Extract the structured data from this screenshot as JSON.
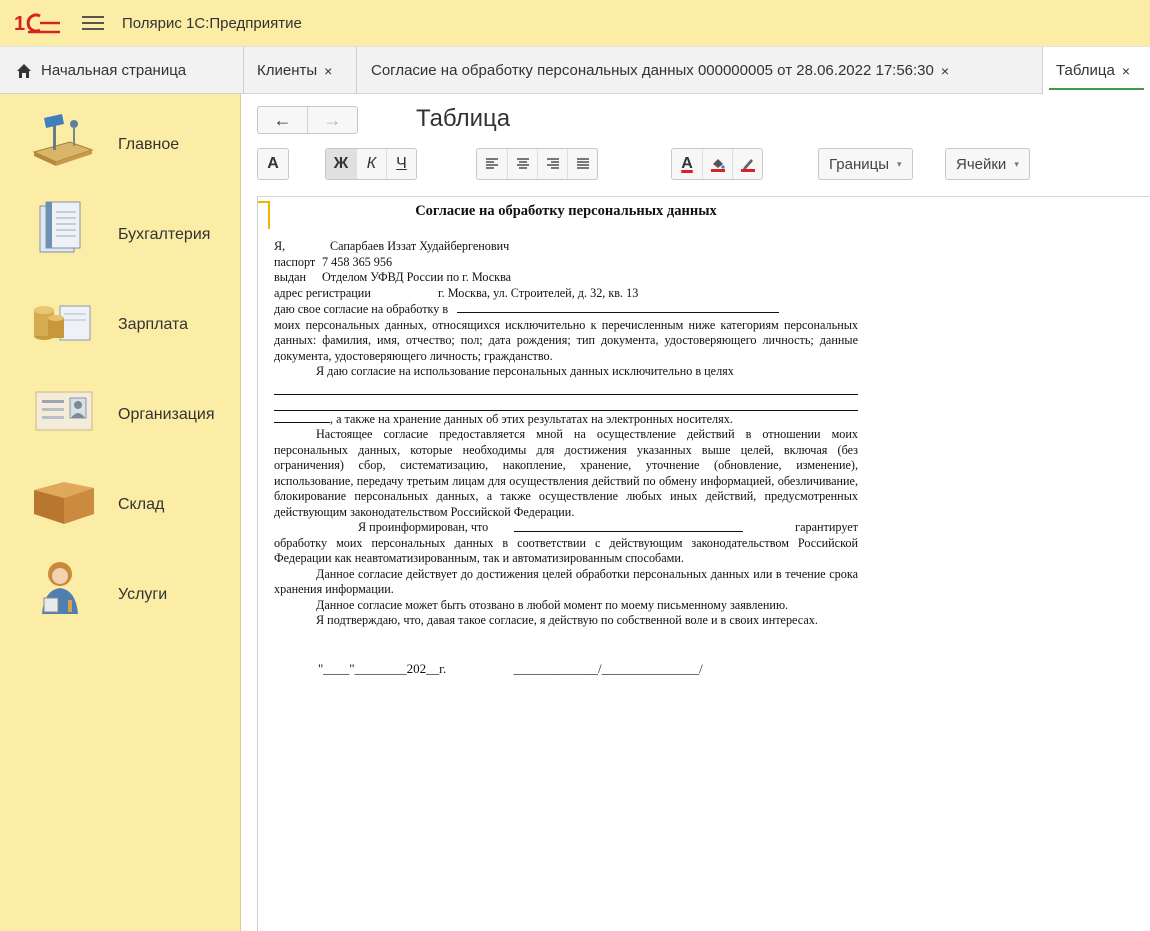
{
  "app": {
    "title": "Полярис 1С:Предприятие",
    "logo_text": "1С",
    "colors": {
      "accent": "#fbeca6",
      "brand_red": "#d6231f",
      "active_tab_underline": "#3d9a4b"
    }
  },
  "tabs": {
    "home": "Начальная страница",
    "open": [
      {
        "label": "Клиенты"
      },
      {
        "label": "Согласие на обработку персональных данных 000000005 от 28.06.2022 17:56:30"
      },
      {
        "label": "Таблица"
      }
    ],
    "close_glyph": "×"
  },
  "sidebar": {
    "items": [
      {
        "label": "Главное",
        "icon": "desk-lamp-icon"
      },
      {
        "label": "Бухгалтерия",
        "icon": "ledger-books-icon"
      },
      {
        "label": "Зарплата",
        "icon": "coins-icon"
      },
      {
        "label": "Организация",
        "icon": "id-card-icon"
      },
      {
        "label": "Склад",
        "icon": "box-icon"
      },
      {
        "label": "Услуги",
        "icon": "service-person-icon"
      }
    ]
  },
  "content": {
    "title": "Таблица",
    "nav": {
      "back": "←",
      "forward": "→"
    },
    "toolbar": {
      "font": "А",
      "bold": "Ж",
      "italic": "К",
      "underline": "Ч",
      "text_color": "А",
      "borders": "Границы",
      "cells": "Ячейки"
    }
  },
  "document": {
    "title": "Согласие на обработку персональных данных",
    "i_label": "Я,",
    "person_name": "Сапарбаев Иззат Худайбергенович",
    "passport_label": "паспорт",
    "passport_number": "7 458 365 956",
    "issued_label": "выдан",
    "issued_by": "Отделом УФВД России по г. Москва",
    "address_label": "адрес регистрации",
    "address": "г. Москва, ул. Строителей, д. 32, кв. 13",
    "consent_to": "даю свое согласие на обработку в",
    "p_categories": "моих персональных данных, относящихся исключительно к перечисленным ниже категориям персональных данных: фамилия, имя, отчество; пол; дата рождения; тип документа, удостоверяющего личность; данные документа, удостоверяющего личность; гражданство.",
    "p_purpose": "Я даю согласие на использование персональных данных исключительно в целях",
    "p_storage": ", а также на хранение данных об этих результатах на электронных носителях.",
    "p_actions": "Настоящее согласие предоставляется мной на осуществление действий в отношении моих персональных данных, которые необходимы для достижения указанных выше целей, включая (без ограничения) сбор, систематизацию, накопление, хранение, уточнение (обновление, изменение), использование, передачу третьим лицам для осуществления действий по обмену информацией, обезличивание, блокирование персональных данных, а также осуществление любых иных действий, предусмотренных действующим законодательством Российской Федерации.",
    "p_informed_a": "Я проинформирован, что",
    "p_informed_b": "гарантирует",
    "p_informed_c": "обработку моих персональных данных в соответствии с действующим законодательством Российской Федерации как неавтоматизированным, так и автоматизированным способами.",
    "p_valid": "Данное согласие действует до достижения целей обработки персональных данных или в течение срока хранения информации.",
    "p_revoke": "Данное согласие может быть отозвано в любой момент по моему  письменному заявлению.",
    "p_confirm": "Я подтверждаю, что, давая такое согласие, я действую по собственной воле и в своих интересах.",
    "sign_date": "\"____\"________202__г.",
    "sign_line": "_____________/_______________/"
  }
}
